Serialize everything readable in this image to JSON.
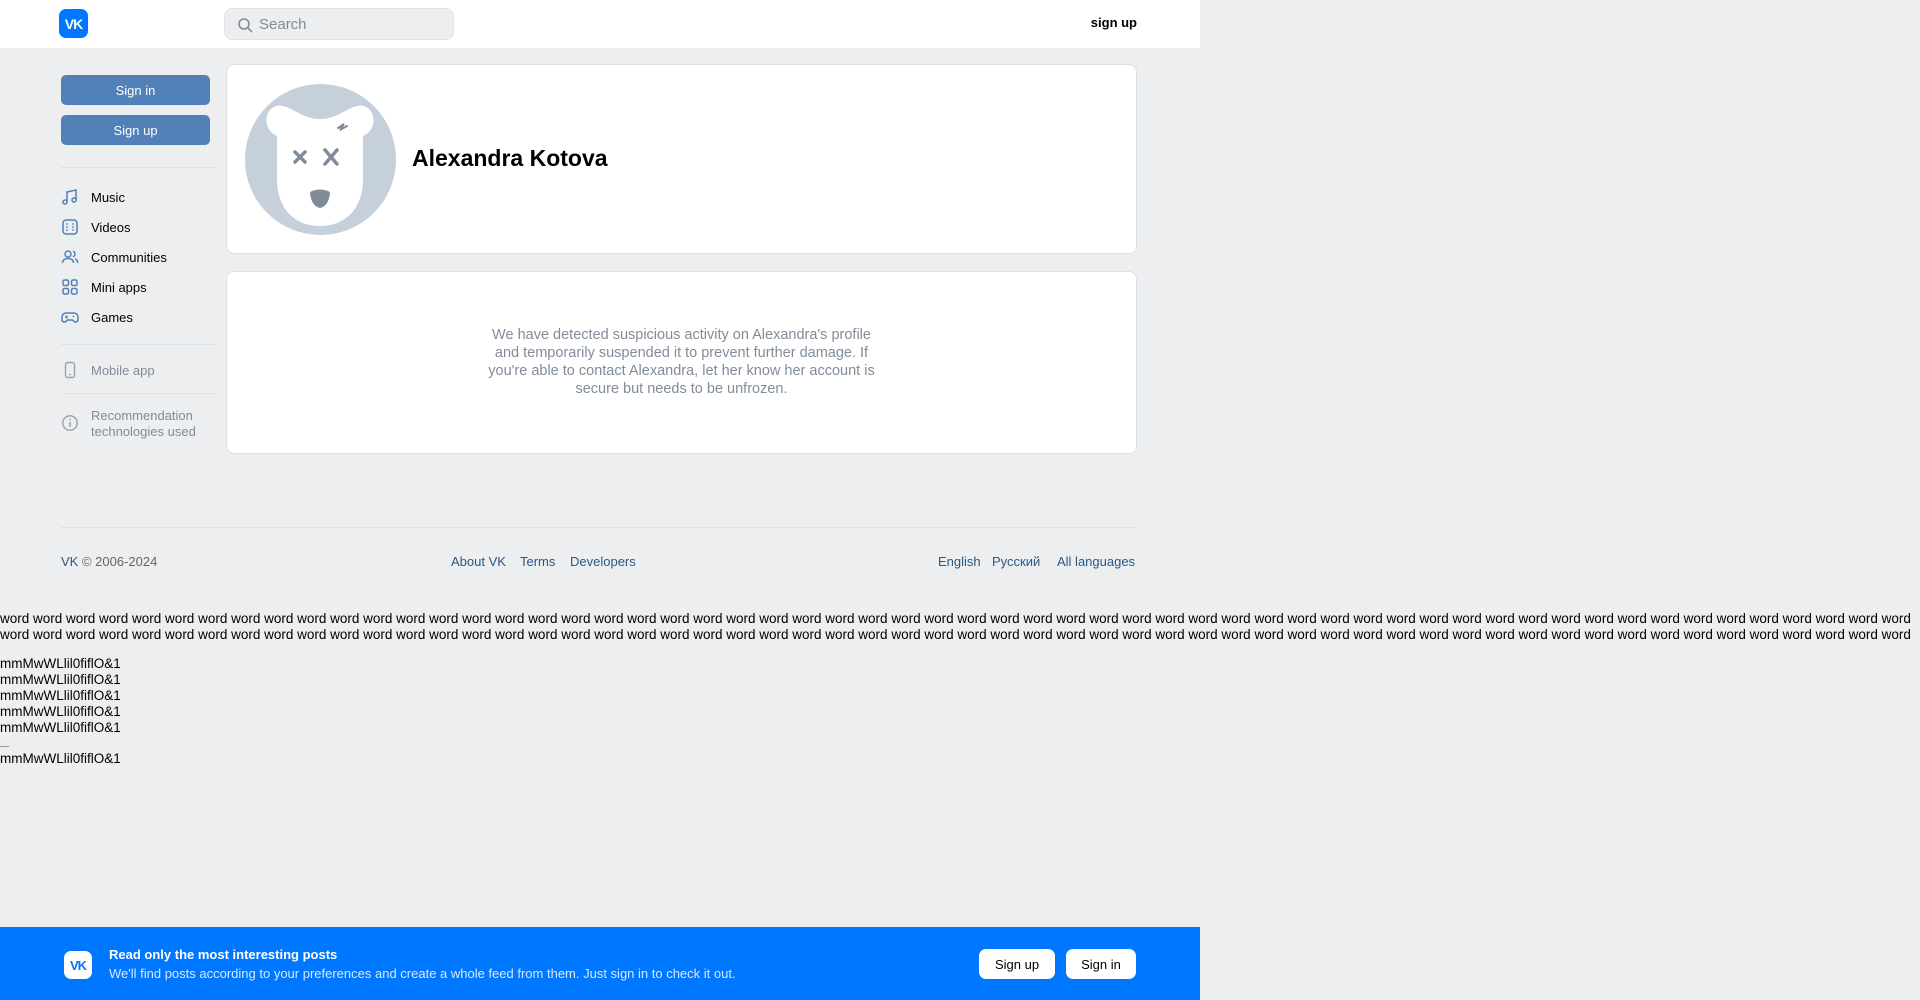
{
  "header": {
    "logo": "VK",
    "search_placeholder": "Search",
    "signup_label": "sign up"
  },
  "sidebar": {
    "signin_label": "Sign in",
    "signup_label": "Sign up",
    "nav": [
      {
        "label": "Music",
        "icon": "music-note-icon"
      },
      {
        "label": "Videos",
        "icon": "video-icon"
      },
      {
        "label": "Communities",
        "icon": "users-icon"
      },
      {
        "label": "Mini apps",
        "icon": "grid-icon"
      },
      {
        "label": "Games",
        "icon": "gamepad-icon"
      }
    ],
    "mobile_app_label": "Mobile app",
    "recommendation_label": "Recommendation technologies used"
  },
  "profile": {
    "name": "Alexandra Kotova",
    "notice": "We have detected suspicious activity on Alexandra's profile and temporarily suspended it to prevent further damage. If you're able to contact Alexandra, let her know her account is secure but needs to be unfrozen."
  },
  "footer": {
    "brand": "VK",
    "copyright": "© 2006-2024",
    "links": [
      "About VK",
      "Terms",
      "Developers"
    ],
    "languages": [
      "English",
      "Русский",
      "All languages"
    ]
  },
  "test_text": {
    "word": "word",
    "glyphs": "mmMwWLlil0fiflO&1"
  },
  "banner": {
    "title": "Read only the most interesting posts",
    "subtitle": "We'll find posts according to your preferences and create a whole feed from them. Just sign in to check it out.",
    "signup_label": "Sign up",
    "signin_label": "Sign in"
  },
  "colors": {
    "accent": "#0077ff",
    "button": "#5181b8",
    "page_bg": "#edeef0",
    "link": "#2a5885",
    "muted": "#818c99"
  }
}
